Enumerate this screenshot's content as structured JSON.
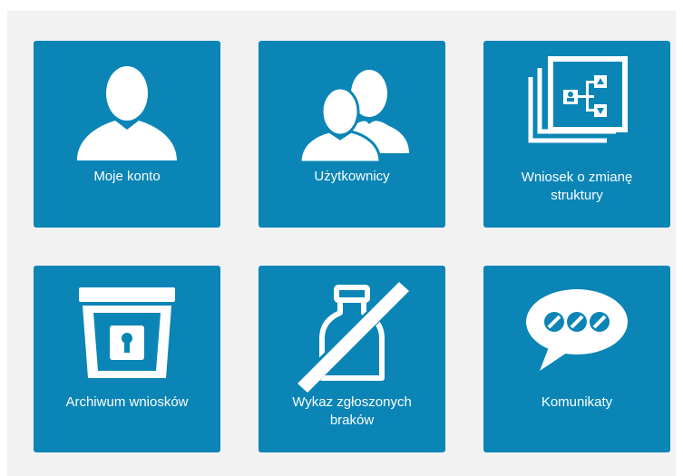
{
  "colors": {
    "tile_background": "#0a85b6",
    "panel_background": "#f2f2f2",
    "icon_foreground": "#ffffff"
  },
  "tiles": [
    {
      "label": "Moje konto",
      "icon": "user-icon"
    },
    {
      "label": "Użytkownicy",
      "icon": "users-icon"
    },
    {
      "label": "Wniosek o zmianę\nstruktury",
      "icon": "structure-change-icon"
    },
    {
      "label": "Archiwum wniosków",
      "icon": "archive-box-icon"
    },
    {
      "label": "Wykaz zgłoszonych\nbraków",
      "icon": "crossed-bottle-icon"
    },
    {
      "label": "Komunikaty",
      "icon": "speech-bubble-icon"
    }
  ]
}
